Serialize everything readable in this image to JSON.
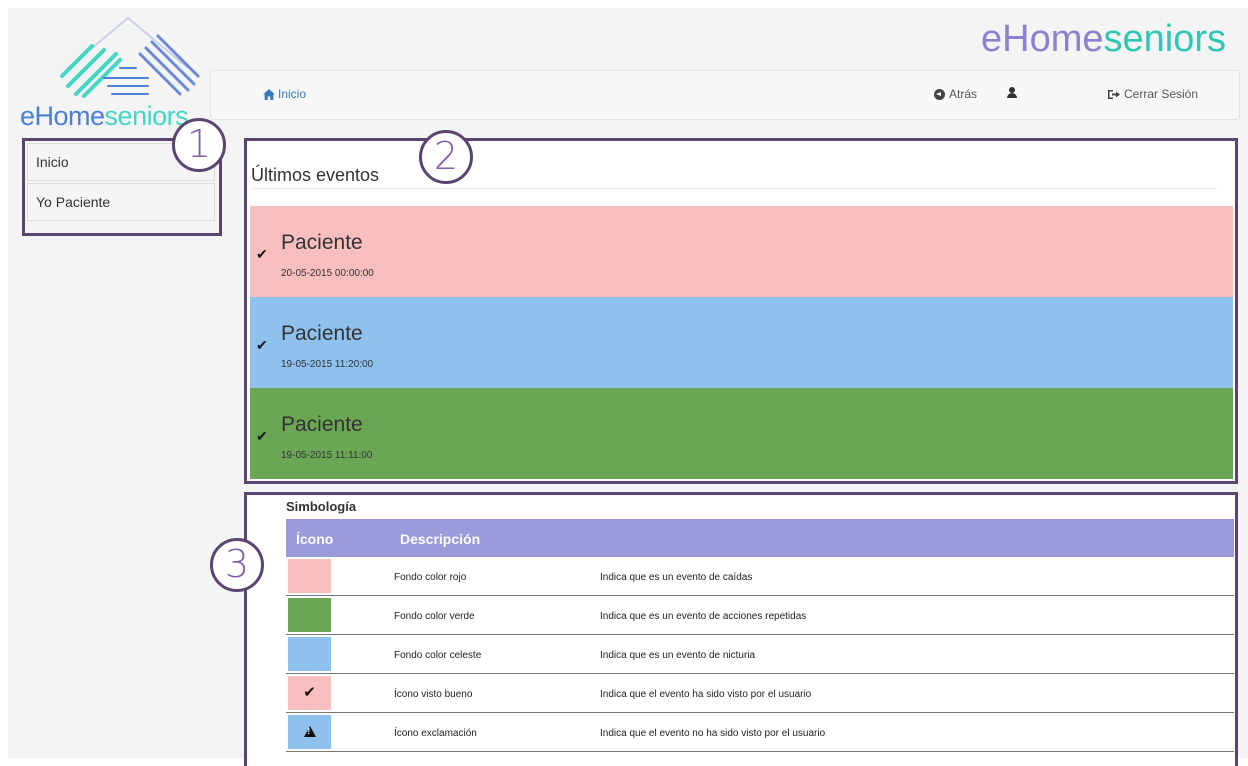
{
  "brand": {
    "logo_part1": "eHome",
    "logo_part2": "seniors",
    "title_part1": "eHome",
    "title_part2": "seniors"
  },
  "navbar": {
    "home_label": "Inicio",
    "back_label": "Atrás",
    "logout_label": "Cerrar Sesión"
  },
  "sidebar": {
    "items": [
      {
        "label": "Inicio"
      },
      {
        "label": "Yo Paciente"
      }
    ]
  },
  "annotations": [
    "1",
    "2",
    "3"
  ],
  "events": {
    "title": "Últimos eventos",
    "items": [
      {
        "name": "Paciente",
        "time": "20-05-2015 00:00:00",
        "color": "#f9bfbf",
        "icon": "check-icon"
      },
      {
        "name": "Paciente",
        "time": "19-05-2015 11:20:00",
        "color": "#8fc1ef",
        "icon": "check-icon"
      },
      {
        "name": "Paciente",
        "time": "19-05-2015 11:11:00",
        "color": "#6ba654",
        "icon": "check-icon"
      }
    ]
  },
  "legend": {
    "title": "Simbología",
    "col_icon": "Ícono",
    "col_desc": "Descripción",
    "rows": [
      {
        "swatch": "#f9bfbf",
        "icon": "",
        "label": "Fondo color rojo",
        "desc": "Indica que es un evento de caídas"
      },
      {
        "swatch": "#6ba654",
        "icon": "",
        "label": "Fondo color verde",
        "desc": "Indica que es un evento de acciones repetidas"
      },
      {
        "swatch": "#8fc1ef",
        "icon": "",
        "label": "Fondo color celeste",
        "desc": "Indica que es un evento de nicturia"
      },
      {
        "swatch": "#f9bfbf",
        "icon": "check-icon",
        "label": "Ícono visto bueno",
        "desc": "Indica que el evento ha sido visto por el usuario"
      },
      {
        "swatch": "#8fc1ef",
        "icon": "warning-icon",
        "label": "Ícono exclamación",
        "desc": "Indica que el evento no ha sido visto por el usuario"
      }
    ]
  },
  "colors": {
    "annotation_border": "#5a4470",
    "legend_header": "#9b9bdb",
    "link": "#337ab7"
  }
}
